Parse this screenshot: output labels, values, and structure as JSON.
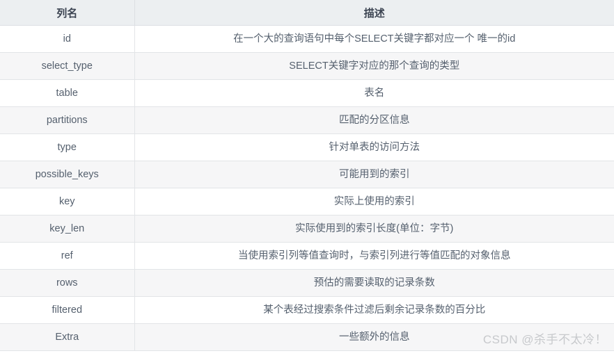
{
  "table": {
    "headers": {
      "name": "列名",
      "description": "描述"
    },
    "rows": [
      {
        "name": "id",
        "description": "在一个大的查询语句中每个SELECT关键字都对应一个 唯一的id"
      },
      {
        "name": "select_type",
        "description": "SELECT关键字对应的那个查询的类型"
      },
      {
        "name": "table",
        "description": "表名"
      },
      {
        "name": "partitions",
        "description": "匹配的分区信息"
      },
      {
        "name": "type",
        "description": "针对单表的访问方法"
      },
      {
        "name": "possible_keys",
        "description": "可能用到的索引"
      },
      {
        "name": "key",
        "description": "实际上使用的索引"
      },
      {
        "name": "key_len",
        "description": "实际使用到的索引长度(单位：字节)"
      },
      {
        "name": "ref",
        "description": "当使用索引列等值查询时，与索引列进行等值匹配的对象信息"
      },
      {
        "name": "rows",
        "description": "预估的需要读取的记录条数"
      },
      {
        "name": "filtered",
        "description": "某个表经过搜索条件过滤后剩余记录条数的百分比"
      },
      {
        "name": "Extra",
        "description": "一些额外的信息"
      }
    ]
  },
  "watermark": {
    "text": "CSDN @杀手不太冷！"
  },
  "colors": {
    "header_bg": "#eceff1",
    "row_alt_bg": "#f6f6f7",
    "row_bg": "#ffffff",
    "border": "#e2e4e7",
    "text": "#55606e",
    "watermark": "#c7c9cc"
  }
}
